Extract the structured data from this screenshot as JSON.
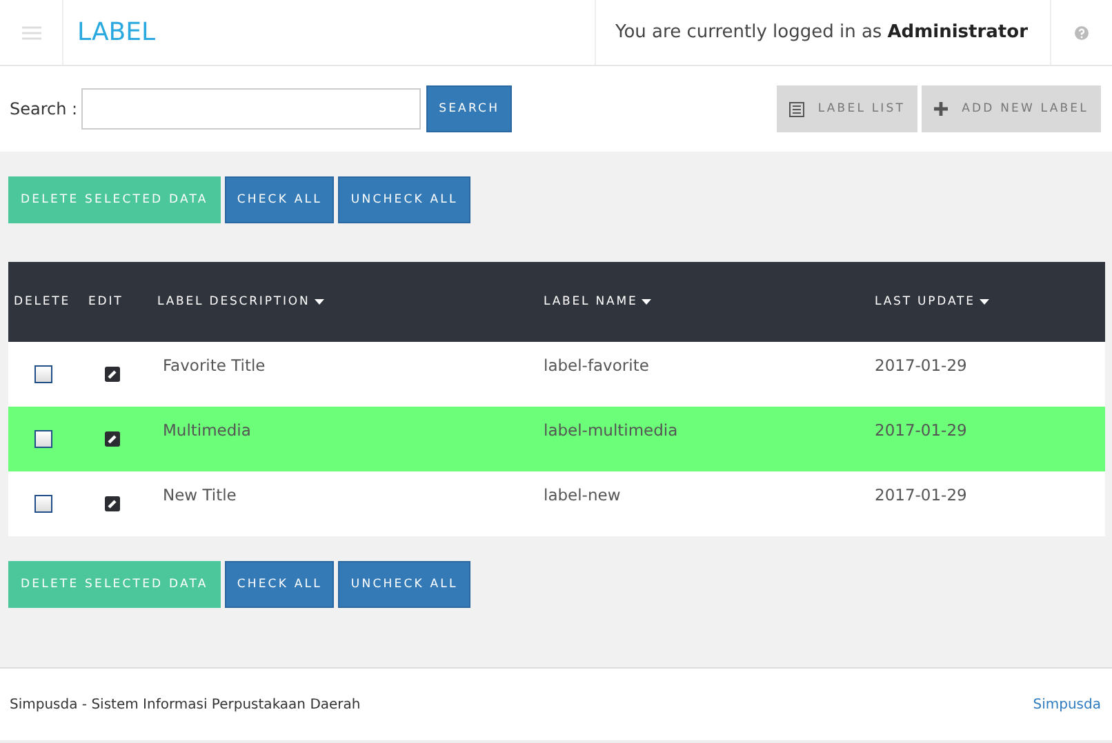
{
  "header": {
    "title": "LABEL",
    "login_text": "You are currently logged in as",
    "user": "Administrator"
  },
  "search": {
    "label": "Search :",
    "button": "SEARCH"
  },
  "nav_buttons": [
    {
      "kind": "list",
      "label": "LABEL LIST"
    },
    {
      "kind": "add",
      "label": "ADD NEW LABEL"
    }
  ],
  "actions_top": [
    {
      "kind": "delete",
      "label": "DELETE SELECTED DATA"
    },
    {
      "kind": "check",
      "label": "CHECK ALL"
    },
    {
      "kind": "uncheck",
      "label": "UNCHECK ALL"
    }
  ],
  "table": {
    "columns": [
      {
        "label": "DELETE",
        "sortable": false
      },
      {
        "label": "EDIT",
        "sortable": false
      },
      {
        "label": "LABEL DESCRIPTION",
        "sortable": true
      },
      {
        "label": "LABEL NAME",
        "sortable": true
      },
      {
        "label": "LAST UPDATE",
        "sortable": true
      }
    ],
    "rows": [
      {
        "description": "Favorite Title",
        "name": "label-favorite",
        "updated": "2017-01-29",
        "checked": false,
        "selected": false
      },
      {
        "description": "Multimedia",
        "name": "label-multimedia",
        "updated": "2017-01-29",
        "checked": false,
        "selected": true
      },
      {
        "description": "New Title",
        "name": "label-new",
        "updated": "2017-01-29",
        "checked": false,
        "selected": false
      }
    ]
  },
  "actions_bottom": [
    {
      "kind": "delete",
      "label": "DELETE SELECTED DATA"
    },
    {
      "kind": "check",
      "label": "CHECK ALL"
    },
    {
      "kind": "uncheck",
      "label": "UNCHECK ALL"
    }
  ],
  "footer": {
    "text": "Simpusda - Sistem Informasi Perpustakaan Daerah",
    "link": "Simpusda"
  }
}
